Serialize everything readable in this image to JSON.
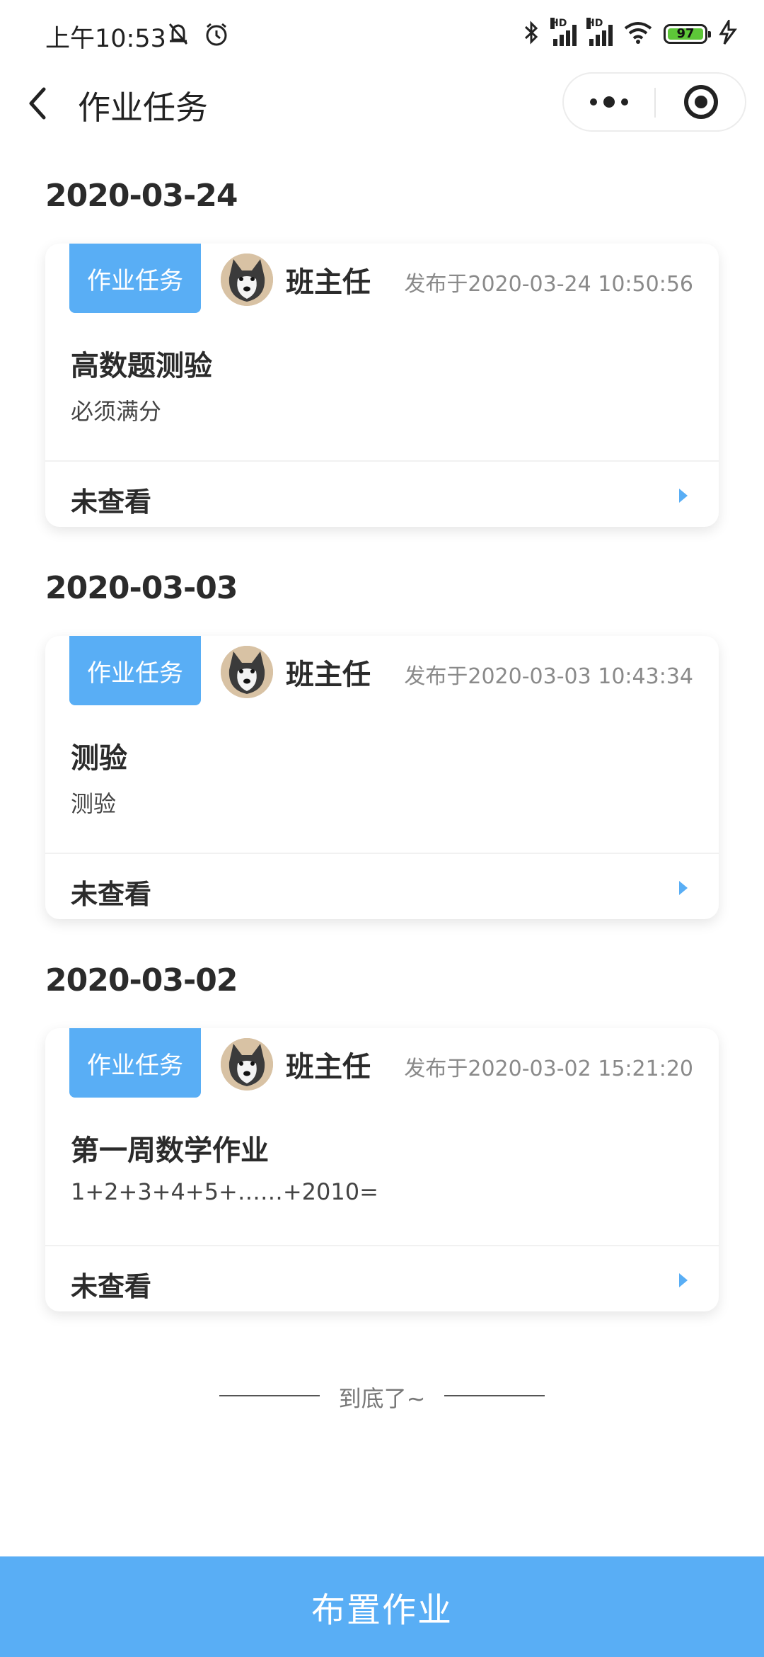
{
  "status_bar": {
    "time": "上午10:53",
    "battery": "97",
    "signal_label": "HD",
    "battery_color": "#5dc738"
  },
  "nav": {
    "title": "作业任务"
  },
  "colors": {
    "accent": "#59aef5",
    "text_primary": "#2b2b2b",
    "text_secondary": "#8a8a8a"
  },
  "tasks": [
    {
      "date": "2020-03-24",
      "badge": "作业任务",
      "author": "班主任",
      "published": "发布于2020-03-24 10:50:56",
      "title": "高数题测验",
      "description": "必须满分",
      "status": "未查看"
    },
    {
      "date": "2020-03-03",
      "badge": "作业任务",
      "author": "班主任",
      "published": "发布于2020-03-03 10:43:34",
      "title": "测验",
      "description": "测验",
      "status": "未查看"
    },
    {
      "date": "2020-03-02",
      "badge": "作业任务",
      "author": "班主任",
      "published": "发布于2020-03-02 15:21:20",
      "title": "第一周数学作业",
      "description": "1+2+3+4+5+……+2010=",
      "status": "未查看"
    }
  ],
  "end_note": "到底了~",
  "bottom_button": "布置作业"
}
